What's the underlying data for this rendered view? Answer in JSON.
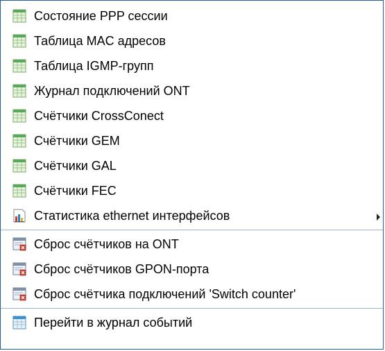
{
  "menu": {
    "group1": [
      {
        "label": "Состояние PPP сессии",
        "icon": "table-icon"
      },
      {
        "label": "Таблица MAC адресов",
        "icon": "table-icon"
      },
      {
        "label": "Таблица IGMP-групп",
        "icon": "table-icon"
      },
      {
        "label": "Журнал подключений ONT",
        "icon": "table-icon"
      },
      {
        "label": "Счётчики CrossConect",
        "icon": "table-icon"
      },
      {
        "label": "Счётчики GEM",
        "icon": "table-icon"
      },
      {
        "label": "Счётчики GAL",
        "icon": "table-icon"
      },
      {
        "label": "Счётчики FEC",
        "icon": "table-icon"
      },
      {
        "label": "Статистика ethernet интерфейсов",
        "icon": "bar-chart-icon",
        "submenu": true
      }
    ],
    "group2": [
      {
        "label": "Сброс счётчиков на ONT",
        "icon": "reset-counter-icon"
      },
      {
        "label": "Сброс счётчиков GPON-порта",
        "icon": "reset-counter-icon"
      },
      {
        "label": "Сброс счётчика подключений 'Switch counter'",
        "icon": "reset-counter-icon"
      }
    ],
    "group3": [
      {
        "label": "Перейти в журнал событий",
        "icon": "event-log-icon"
      }
    ]
  },
  "colors": {
    "border": "#1f5f9f",
    "separator": "#9bb3cc",
    "table_icon_header": "#5aa85a",
    "table_icon_body": "#e8f3e0",
    "event_icon_header": "#3a8fd0",
    "reset_icon_red": "#d03a2a"
  }
}
